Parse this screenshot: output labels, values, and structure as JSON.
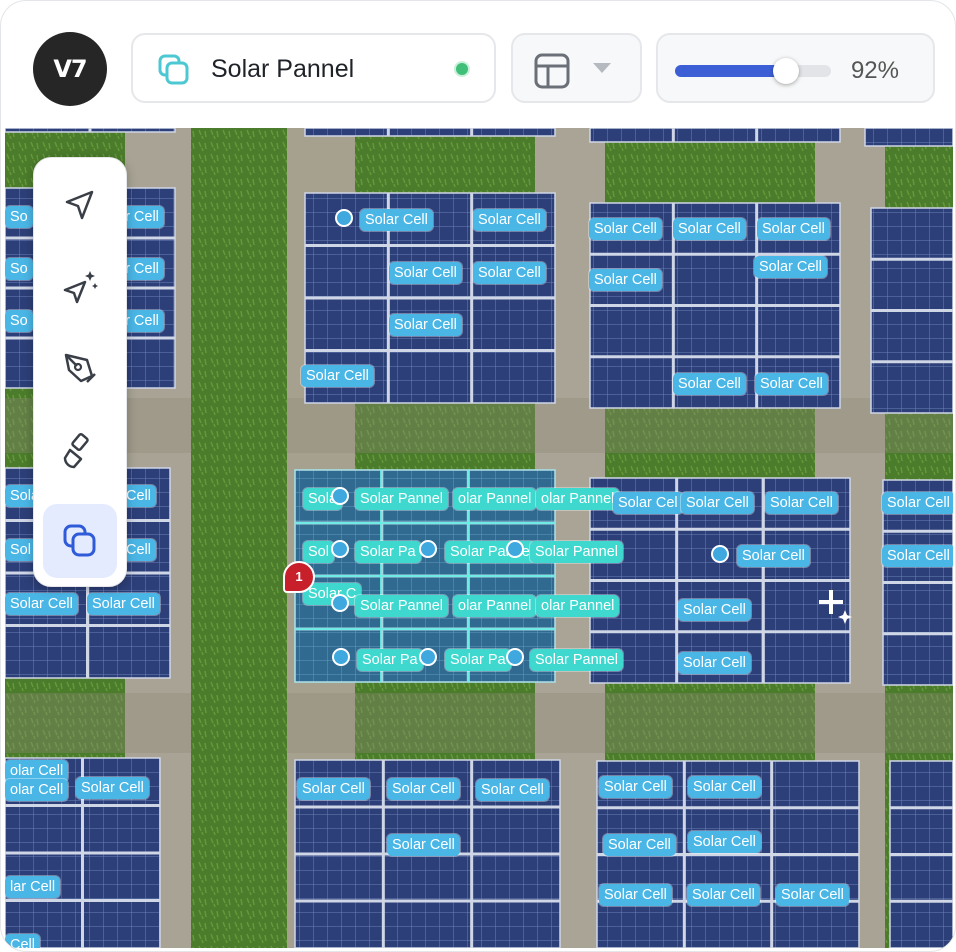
{
  "logo": {
    "text": "V7"
  },
  "class_selector": {
    "name": "Solar Pannel",
    "status_color": "#3fbf78"
  },
  "layout_menu": {
    "icon": "layout-icon"
  },
  "opacity": {
    "value": 92,
    "label": "92%"
  },
  "toolbar": {
    "tools": [
      {
        "icon": "select-arrow-icon",
        "active": false
      },
      {
        "icon": "auto-annotate-icon",
        "active": false
      },
      {
        "icon": "pen-icon",
        "active": false
      },
      {
        "icon": "brush-icon",
        "active": false
      },
      {
        "icon": "polygon-class-icon",
        "active": true
      }
    ]
  },
  "comment": {
    "count": "1"
  },
  "annotations": {
    "cell_label": "Solar Cell",
    "panel_label": "Solar Pannel",
    "panel_label_cut_1": "olar Pannel",
    "panel_label_cut_2": "Solar Panne",
    "panel_label_cut_3": "Solar Pa",
    "cell_cut_left": "ar Cell",
    "cell_cut_right": "So",
    "cell_cut_4": "olar Cell",
    "cell_cut_5": "lar Cell",
    "cell_cut_6": "Sola",
    "cell_cut_7": "Solar C",
    "cell_cut_8": "Cell",
    "cell_cut_9": "Sol",
    "cell_cut_10": "Solar Cel"
  },
  "colors": {
    "accent": "#3c5fd6",
    "cell_tag": "#4ab6e6",
    "panel_tag": "#3fd8cf"
  }
}
